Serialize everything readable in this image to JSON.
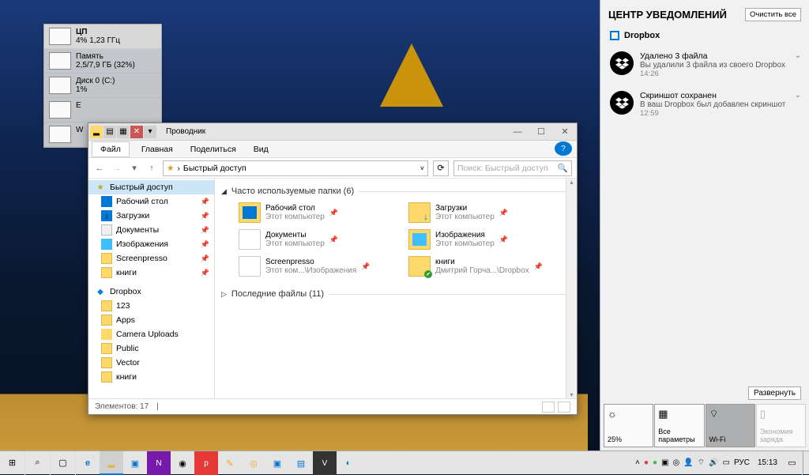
{
  "sysmon": {
    "items": [
      {
        "label": "ЦП",
        "sub": "4%  1,23 ГГц"
      },
      {
        "label": "Память",
        "sub": "2,5/7,9 ГБ (32%)"
      },
      {
        "label": "Диск 0 (C:)",
        "sub": "1%"
      },
      {
        "label": "E",
        "sub": ""
      },
      {
        "label": "W",
        "sub": ""
      }
    ]
  },
  "explorer": {
    "title": "Проводник",
    "ribbon": {
      "file": "Файл",
      "home": "Главная",
      "share": "Поделиться",
      "view": "Вид"
    },
    "path_label": "Быстрый доступ",
    "search_placeholder": "Поиск: Быстрый доступ",
    "sidebar": {
      "quick": "Быстрый доступ",
      "desktop": "Рабочий стол",
      "downloads": "Загрузки",
      "documents": "Документы",
      "pictures": "Изображения",
      "screenpresso": "Screenpresso",
      "books": "книги",
      "dropbox": "Dropbox",
      "d123": "123",
      "apps": "Apps",
      "camera": "Camera Uploads",
      "public": "Public",
      "vector": "Vector",
      "books2": "книги"
    },
    "group_freq": "Часто используемые папки (6)",
    "group_recent": "Последние файлы (11)",
    "items": {
      "desktop": {
        "name": "Рабочий стол",
        "sub": "Этот компьютер"
      },
      "downloads": {
        "name": "Загрузки",
        "sub": "Этот компьютер"
      },
      "documents": {
        "name": "Документы",
        "sub": "Этот компьютер"
      },
      "pictures": {
        "name": "Изображения",
        "sub": "Этот компьютер"
      },
      "screenpresso": {
        "name": "Screenpresso",
        "sub": "Этот ком...\\Изображения"
      },
      "books": {
        "name": "книги",
        "sub": "Дмитрий Горча...\\Dropbox"
      }
    },
    "status": "Элементов: 17"
  },
  "action_center": {
    "title": "ЦЕНТР УВЕДОМЛЕНИЙ",
    "clear_all": "Очистить все",
    "app_name": "Dropbox",
    "notifs": [
      {
        "title": "Удалено 3 файла",
        "text": "Вы удалили 3 файла из своего Dropbox",
        "time": "14:26"
      },
      {
        "title": "Скриншот сохранен",
        "text": "В ваш Dropbox был добавлен скриншот",
        "time": "12:59"
      }
    ],
    "expand": "Развернуть",
    "quick": {
      "brightness": "25%",
      "settings": "Все параметры",
      "wifi": "Wi-Fi",
      "battery": "Экономия заряда"
    }
  },
  "taskbar": {
    "lang": "РУС",
    "time": "15:13"
  }
}
